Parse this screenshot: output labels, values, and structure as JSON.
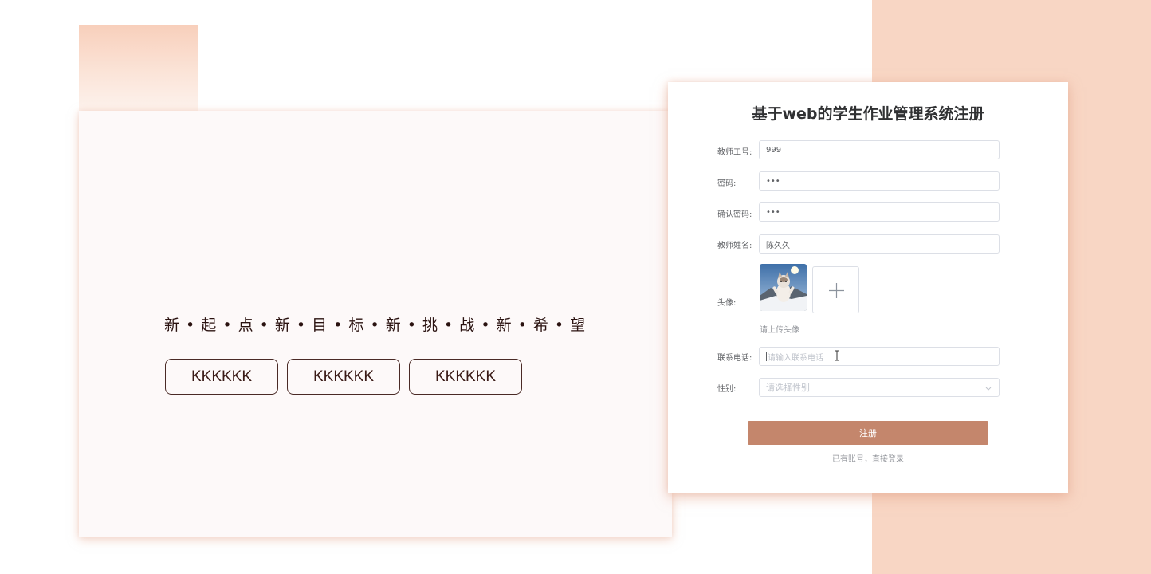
{
  "slogan": "新 • 起 • 点 • 新 • 目 • 标 • 新 • 挑 • 战 • 新 • 希 • 望",
  "buttons": [
    "KKKKKK",
    "KKKKKK",
    "KKKKKK"
  ],
  "register": {
    "title": "基于web的学生作业管理系统注册",
    "fields": {
      "teacher_id": {
        "label": "教师工号:",
        "value": "999"
      },
      "password": {
        "label": "密码:",
        "value": "•••"
      },
      "confirm_password": {
        "label": "确认密码:",
        "value": "•••"
      },
      "teacher_name": {
        "label": "教师姓名:",
        "value": "陈久久"
      },
      "avatar": {
        "label": "头像:",
        "hint": "请上传头像"
      },
      "phone": {
        "label": "联系电话:",
        "placeholder": "请输入联系电话"
      },
      "gender": {
        "label": "性别:",
        "placeholder": "请选择性别"
      }
    },
    "submit_label": "注册",
    "login_link": "已有账号，直接登录"
  },
  "colors": {
    "accent": "#c4866c",
    "deco": "#f8d6c4"
  }
}
